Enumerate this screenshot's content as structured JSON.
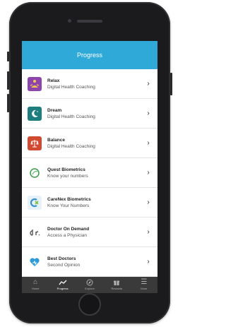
{
  "header": {
    "title": "Progress"
  },
  "items": [
    {
      "title": "Relax",
      "subtitle": "Digital Health Coaching",
      "icon": "meditation-icon",
      "color": "#8e44ad"
    },
    {
      "title": "Dream",
      "subtitle": "Digital Health Coaching",
      "icon": "moon-icon",
      "color": "#1e7d7e"
    },
    {
      "title": "Balance",
      "subtitle": "Digital Health Coaching",
      "icon": "scale-icon",
      "color": "#d04a32"
    },
    {
      "title": "Quest Biometrics",
      "subtitle": "Know your numbers",
      "icon": "quest-logo-icon",
      "color": "#3c9a4a"
    },
    {
      "title": "CareNex Biometrics",
      "subtitle": "Know Your Numbers",
      "icon": "carenex-logo-icon",
      "color": "#3a8fd0"
    },
    {
      "title": "Doctor On Demand",
      "subtitle": "Access a Physician",
      "icon": "doctor-logo-icon",
      "color": "#555555"
    },
    {
      "title": "Best Doctors",
      "subtitle": "Second Opinion",
      "icon": "heart-logo-icon",
      "color": "#2f9bd6"
    }
  ],
  "tabs": [
    {
      "label": "Home",
      "icon": "home-icon",
      "active": false
    },
    {
      "label": "Progress",
      "icon": "trend-icon",
      "active": true
    },
    {
      "label": "Explore",
      "icon": "compass-icon",
      "active": false
    },
    {
      "label": "Rewards",
      "icon": "gift-icon",
      "active": false
    },
    {
      "label": "More",
      "icon": "menu-icon",
      "active": false
    }
  ],
  "colors": {
    "accent": "#2fa9d8",
    "tabbar": "#3a3a3a",
    "phone": "#1b1b1d"
  }
}
